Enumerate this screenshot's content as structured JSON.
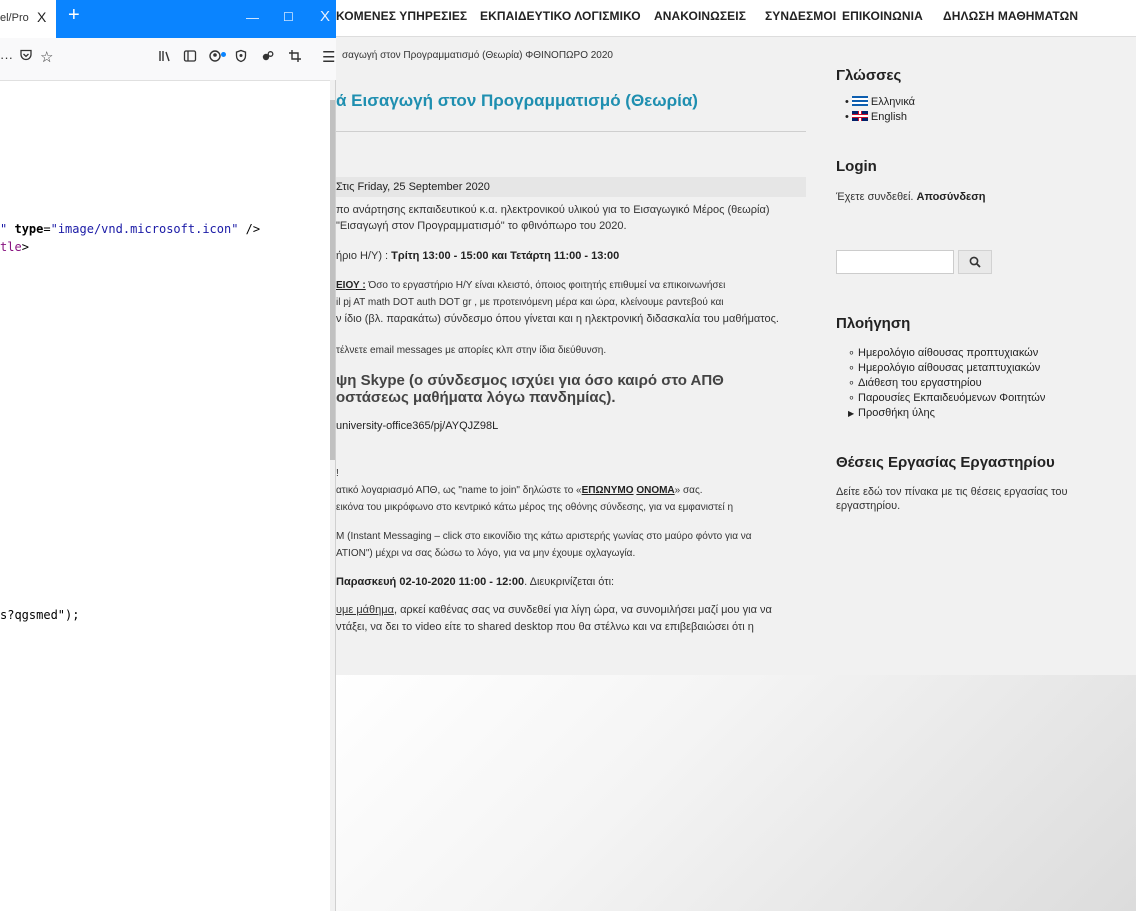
{
  "colors": {
    "tab_strip": "#0a84ff",
    "title_blue": "#1f8fb0",
    "page_bg": "#f1f1f1"
  },
  "browser": {
    "tab_title": "el/Pro",
    "tab_close": "X",
    "new_tab": "+",
    "window_controls": {
      "minimize": "—",
      "maximize": "☐",
      "close": "X"
    },
    "toolbar": {
      "overflow": "···",
      "pocket_icon": "pocket-icon",
      "bookmark_icon": "star-icon",
      "library_icon": "library-icon",
      "sidebar_icon": "sidebar-icon",
      "menu_icon": "hamburger-icon"
    }
  },
  "source_code": {
    "line1_attr_value_end": "\"",
    "line1_attr": "type",
    "line1_value": "\"image/vnd.microsoft.icon\"",
    "line1_close": " />",
    "line2_fragment": "tle",
    "line2_close": ">",
    "line3": "s?qgsmed\");"
  },
  "topnav": [
    "ΚΟΜΕΝΕΣ ΥΠΗΡΕΣΙΕΣ",
    "ΕΚΠΑΙΔΕΥΤΙΚΟ ΛΟΓΙΣΜΙΚΟ",
    "ΑΝΑΚΟΙΝΩΣΕΙΣ",
    "ΣΥΝΔΕΣΜΟΙ",
    "ΕΠΙΚΟΙΝΩΝΙΑ",
    "ΔΗΛΩΣΗ ΜΑΘΗΜΑΤΩΝ"
  ],
  "breadcrumb": "σαγωγή στον Προγραμματισμό (Θεωρία) ΦΘΙΝΟΠΩΡΟ 2020",
  "article": {
    "title": "ά Εισαγωγή στον Προγραμματισμό (Θεωρία)",
    "dateline_prefix": "Στις",
    "dateline_date": "Friday, 25 September 2020",
    "p1a": "πο ανάρτησης εκπαιδευτικού κ.α. ηλεκτρονικού υλικού για το Εισαγωγικό Μέρος (θεωρία)",
    "p1b": "\"Εισαγωγή στον Προγραμματισμό\" το φθινόπωρο του 2020.",
    "hours_prefix": "ήριο Η/Υ) :",
    "hours": "Τρίτη 13:00 - 15:00 και Τετάρτη 11:00 - 13:00",
    "p2_lead": "ΕΙΟΥ :",
    "p2a": " Όσο το εργαστήριο Η/Υ είναι κλειστό, όποιος φοιτητής επιθυμεί να επικοινωνήσει",
    "p2b": "il pj AT math DOT auth DOT gr , με προτεινόμενη μέρα και ώρα, κλείνουμε ραντεβού και",
    "p2c": "ν ίδιο (βλ. παρακάτω) σύνδεσμο όπου γίνεται και η ηλεκτρονική διδασκαλία του μαθήματος.",
    "p3": "τέλνετε email messages με απορίες κλπ στην ίδια διεύθυνση.",
    "heading_a": "ψη Skype (ο σύνδεσμος ισχύει για όσο καιρό στο ΑΠΘ",
    "heading_b": "οστάσεως μαθήματα λόγω πανδημίας).",
    "link": "university-office365/pj/AYQJZ98L",
    "exclaim": "!",
    "p4_prefix": "ατικό λογαριασμό ΑΠΘ, ως \"name to join\" δηλώστε το «",
    "p4_surname": "ΕΠΩΝΥΜΟ",
    "p4_space": " ",
    "p4_name": "ΟΝΟΜΑ",
    "p4_suffix": "» σας.",
    "p5": "εικόνα του μικρόφωνο στο κεντρικό κάτω μέρος της οθόνης σύνδεσης, για να εμφανιστεί η",
    "p6a": "Μ (Instant Messaging – click στο εικονίδιο της κάτω αριστερής γωνίας στο μαύρο φόντο για να",
    "p6b": "ATION\") μέχρι να σας δώσω το λόγο, για να μην έχουμε οχλαγωγία.",
    "p7_prefix": "Παρασκευή 02-10-2020 11:00 - 12:00",
    "p7_suffix": ". Διευκρινίζεται ότι:",
    "p8_u": "υμε μάθημα",
    "p8a": ", αρκεί καθένας σας να συνδεθεί για λίγη ώρα, να συνομιλήσει μαζί μου για να",
    "p8b": "ντάξει, να δει το video είτε το shared desktop που θα στέλνω και να επιβεβαιώσει ότι η"
  },
  "sidebar": {
    "languages_title": "Γλώσσες",
    "languages": [
      {
        "label": "Ελληνικά",
        "flag": "greece-flag-icon"
      },
      {
        "label": "English",
        "flag": "uk-flag-icon"
      }
    ],
    "login_title": "Login",
    "login_text": "Έχετε συνδεθεί.",
    "logout": "Αποσύνδεση",
    "search_placeholder": "",
    "nav_title": "Πλοήγηση",
    "nav_items": [
      "Ημερολόγιο αίθουσας προπτυχιακών",
      "Ημερολόγιο αίθουσας μεταπτυχιακών",
      "Διάθεση του εργαστηρίου",
      "Παρουσίες Εκπαιδευόμενων Φοιτητών",
      "Προσθήκη ύλης"
    ],
    "jobs_title": "Θέσεις Εργασίας Εργαστηρίου",
    "jobs_text_a": "Δείτε εδώ τον πίνακα με τις θέσεις εργασίας του",
    "jobs_text_b": "εργαστηρίου."
  }
}
